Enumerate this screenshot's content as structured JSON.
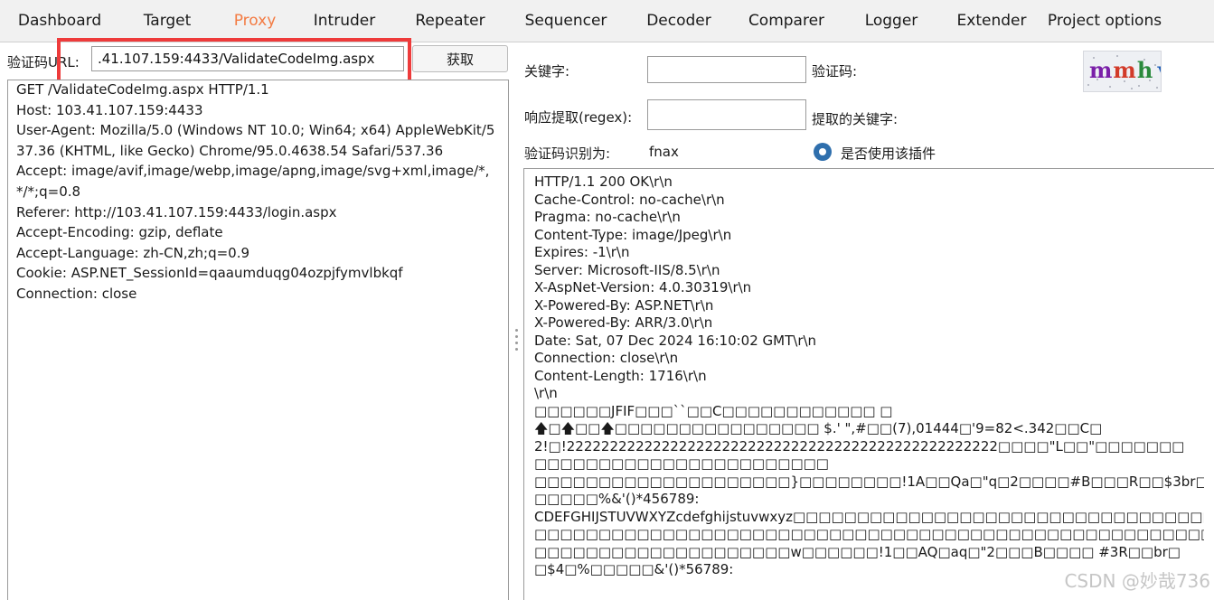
{
  "tabs": [
    {
      "label": "Dashboard",
      "active": false
    },
    {
      "label": "Target",
      "active": false
    },
    {
      "label": "Proxy",
      "active": true
    },
    {
      "label": "Intruder",
      "active": false
    },
    {
      "label": "Repeater",
      "active": false
    },
    {
      "label": "Sequencer",
      "active": false
    },
    {
      "label": "Decoder",
      "active": false
    },
    {
      "label": "Comparer",
      "active": false
    },
    {
      "label": "Logger",
      "active": false
    },
    {
      "label": "Extender",
      "active": false
    },
    {
      "label": "Project options",
      "active": false
    }
  ],
  "left": {
    "url_label": "验证码URL:",
    "url_value": ".41.107.159:4433/ValidateCodeImg.aspx",
    "fetch_button": "获取",
    "request_lines": [
      "GET /ValidateCodeImg.aspx HTTP/1.1",
      "Host: 103.41.107.159:4433",
      "User-Agent: Mozilla/5.0 (Windows NT 10.0; Win64; x64) AppleWebKit/537.36 (KHTML, like Gecko) Chrome/95.0.4638.54 Safari/537.36",
      "Accept: image/avif,image/webp,image/apng,image/svg+xml,image/*,*/*;q=0.8",
      "Referer: http://103.41.107.159:4433/login.aspx",
      "Accept-Encoding: gzip, deflate",
      "Accept-Language: zh-CN,zh;q=0.9",
      "Cookie: ASP.NET_SessionId=qaaumduqg04ozpjfymvlbkqf",
      "Connection: close"
    ]
  },
  "right": {
    "keyword_label": "关键字:",
    "captcha_label": "验证码:",
    "captcha_image_text": "mmhv",
    "regex_label": "响应提取(regex):",
    "extracted_keyword_label": "提取的关键字:",
    "recognized_label": "验证码识别为:",
    "recognized_value": "fnax",
    "plugin_label": "是否使用该插件",
    "plugin_enabled": true,
    "response_lines": [
      "HTTP/1.1 200 OK\\r\\n",
      "Cache-Control: no-cache\\r\\n",
      "Pragma: no-cache\\r\\n",
      "Content-Type: image/Jpeg\\r\\n",
      "Expires: -1\\r\\n",
      "Server: Microsoft-IIS/8.5\\r\\n",
      "X-AspNet-Version: 4.0.30319\\r\\n",
      "X-Powered-By: ASP.NET\\r\\n",
      "X-Powered-By: ARR/3.0\\r\\n",
      "Date: Sat, 07 Dec 2024 16:10:02 GMT\\r\\n",
      "Connection: close\\r\\n",
      "Content-Length: 1716\\r\\n",
      "\\r\\n",
      "□□□□□□JFIF□□□``□□C□□□□□□□□□□□□                              □",
      "🡅□🡅□□🡅□□□□□□□□□□□□□□□□ $.' \",#□□(7),01444□'9=82<.342□□C□",
      "2!□!22222222222222222222222222222222222222222222222222□□□□\"L□□\"□□□□□□□",
      "□□□□□□□□□□□□□□□□□□□□□□□",
      "□□□□□□□□□□□□□□□□□□□□}□□□□□□□□!1A□□Qa□\"q□2□□□□#B□□□R□□$3br□",
      "□□□□□%&'()*456789:",
      "CDEFGHIJSTUVWXYZcdefghijstuvwxyz□□□□□□□□□□□□□□□□□□□□□□□□□□□□□□□□□□□□□□□□□",
      "□□□□□□□□□□□□□□□□□□□□□□□□□□□□□□□□□□□□□□□□□□□□□□□□□□□□□□□□□□□□□□",
      "□□□□□□□□□□□□□□□□□□□□w□□□□□□!1□□AQ□aq□\"2□□□B□□□□     #3R□□br□",
      "□$4□%□□□□□&'()*56789:"
    ]
  },
  "watermark": "CSDN @妙哉736",
  "colors": {
    "active_tab": "#f37b43",
    "highlight_border": "#ee3b3b",
    "radio": "#2f6fad"
  }
}
